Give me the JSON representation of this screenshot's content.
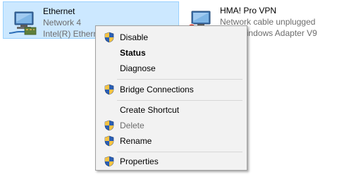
{
  "adapters": [
    {
      "name": "Ethernet",
      "network": "Network 4",
      "device": "Intel(R) Ethernet Connection",
      "icon": "network-adapter-icon",
      "selected": true
    },
    {
      "name": "HMA! Pro VPN",
      "network": "Network cable unplugged",
      "device": "TAP-Windows Adapter V9",
      "icon": "network-adapter-unplugged-icon",
      "selected": false
    }
  ],
  "context_menu": {
    "items": [
      {
        "label": "Disable",
        "shield": true,
        "bold": false,
        "disabled": false
      },
      {
        "label": "Status",
        "shield": false,
        "bold": true,
        "disabled": false
      },
      {
        "label": "Diagnose",
        "shield": false,
        "bold": false,
        "disabled": false
      },
      {
        "label": "Bridge Connections",
        "shield": true,
        "bold": false,
        "disabled": false
      },
      {
        "label": "Create Shortcut",
        "shield": false,
        "bold": false,
        "disabled": false
      },
      {
        "label": "Delete",
        "shield": true,
        "bold": false,
        "disabled": true
      },
      {
        "label": "Rename",
        "shield": true,
        "bold": false,
        "disabled": false
      },
      {
        "label": "Properties",
        "shield": true,
        "bold": false,
        "disabled": false
      }
    ]
  },
  "colors": {
    "selection_bg": "#cce8ff",
    "selection_border": "#99d1ff",
    "menu_bg": "#f2f2f2",
    "disabled_text": "#6d6d6d",
    "shield_blue": "#2b5fb3",
    "shield_yellow": "#f6c343"
  }
}
